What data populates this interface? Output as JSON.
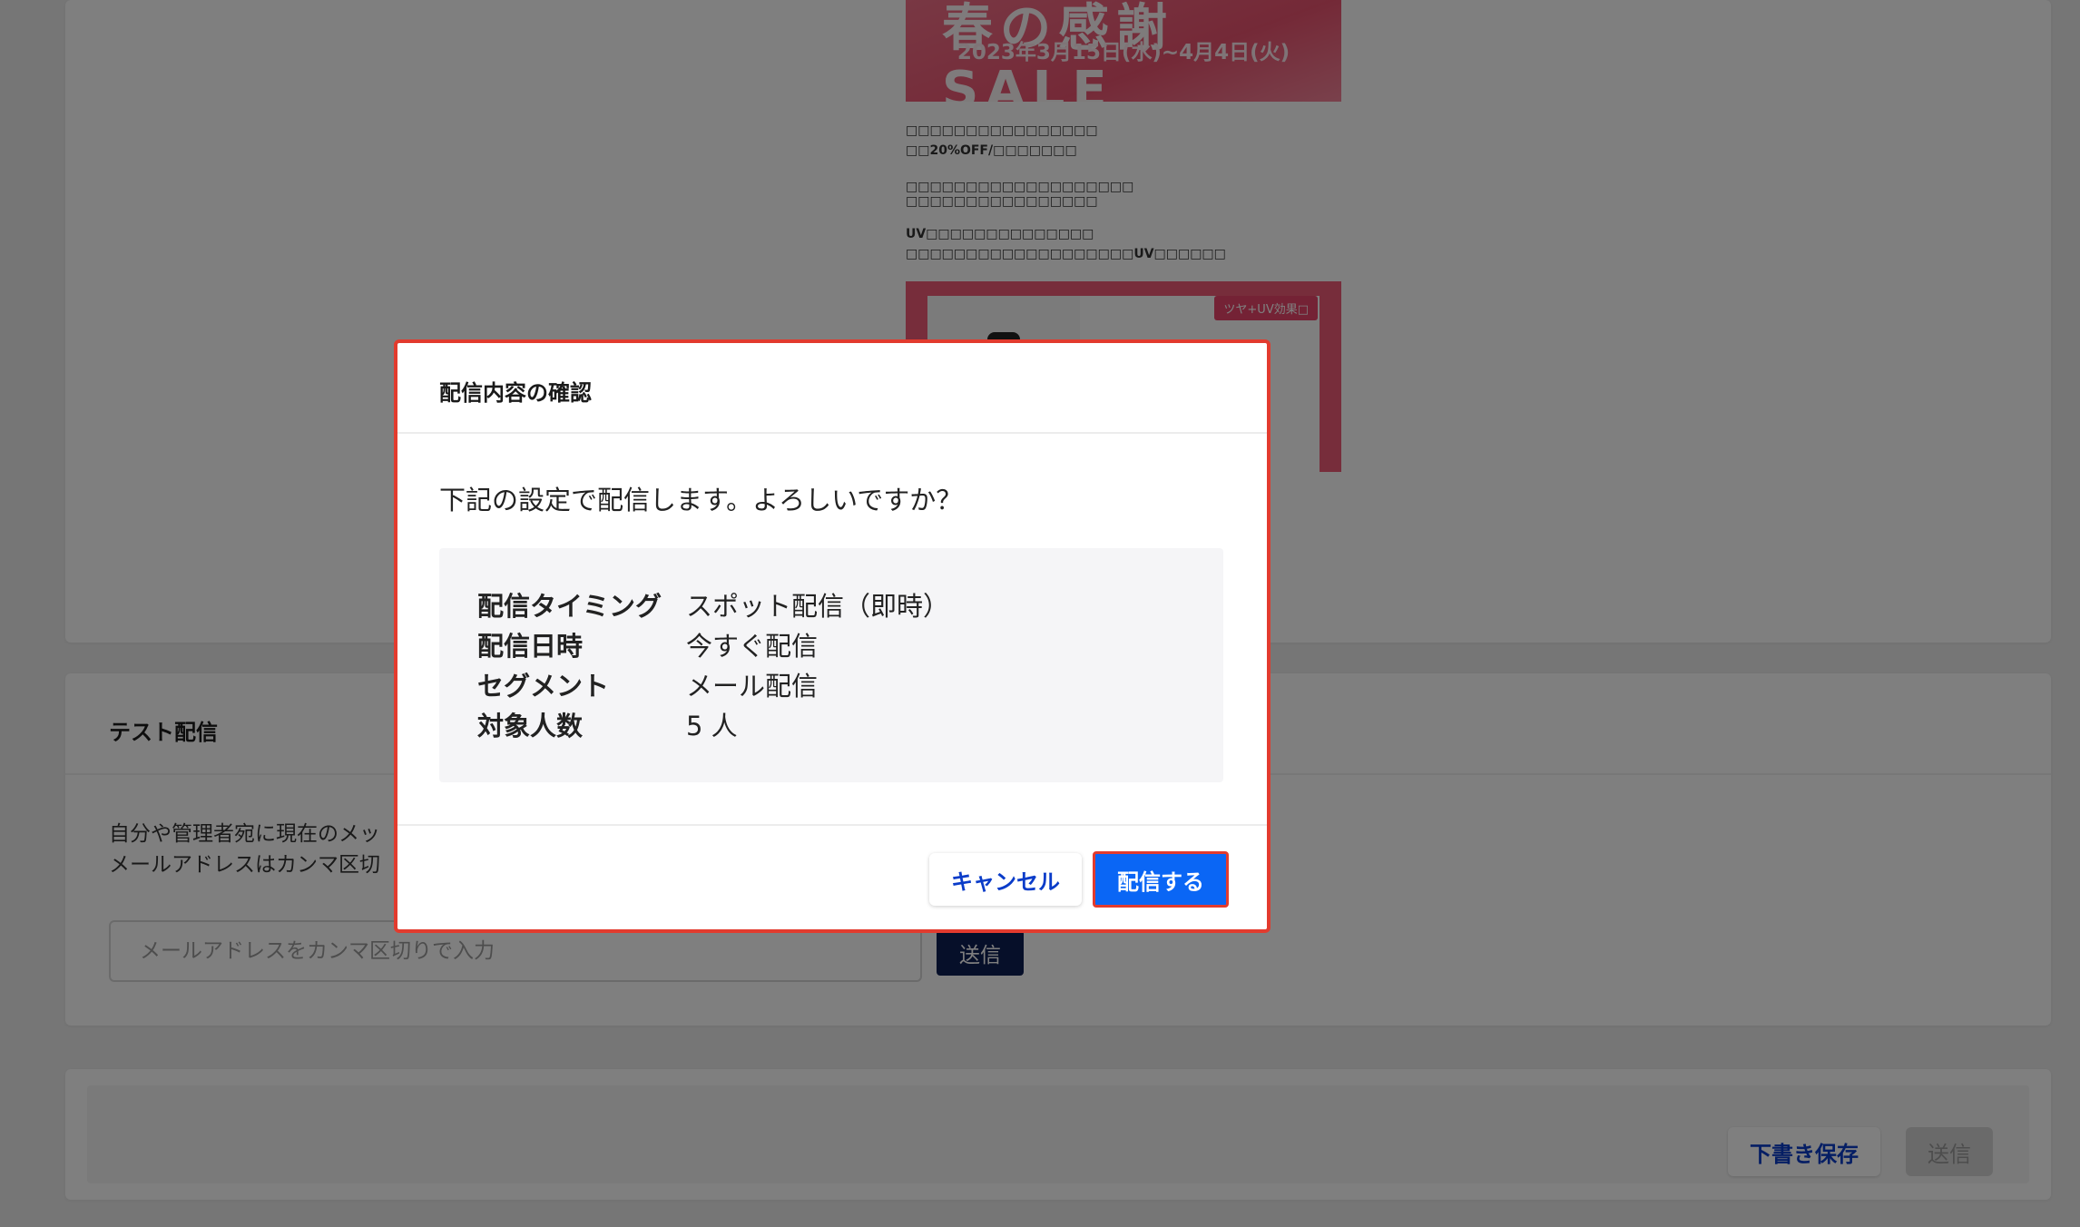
{
  "email_preview": {
    "banner_title": "春の感謝 SALE",
    "banner_date": "2023年3月15日(水)~4月4日(火)",
    "text_lines": [
      "□□□□□□□□□□□□□□□□",
      "□□20%OFF/□□□□□□□",
      "",
      "□□□□□□□□□□□□□□□□□□□",
      "□□□□□□□□□□□□□□□□",
      "",
      "UV□□□□□□□□□□□□□□",
      "□□□□□□□□□□□□□□□□□□□UV□□□□□□"
    ],
    "promo_tag": "ツヤ+UV効果□"
  },
  "test_delivery": {
    "title": "テスト配信",
    "description_line1": "自分や管理者宛に現在のメッ",
    "description_line2": "メールアドレスはカンマ区切",
    "input_placeholder": "メールアドレスをカンマ区切りで入力",
    "send_label": "送信"
  },
  "footer": {
    "draft_label": "下書き保存",
    "send_label": "送信"
  },
  "modal": {
    "title": "配信内容の確認",
    "message": "下記の設定で配信します。よろしいですか？",
    "rows": [
      {
        "key": "配信タイミング",
        "value": "スポット配信（即時）"
      },
      {
        "key": "配信日時",
        "value": "今すぐ配信"
      },
      {
        "key": "セグメント",
        "value": "メール配信"
      },
      {
        "key": "対象人数",
        "value": "5 人"
      }
    ],
    "cancel_label": "キャンセル",
    "confirm_label": "配信する"
  }
}
